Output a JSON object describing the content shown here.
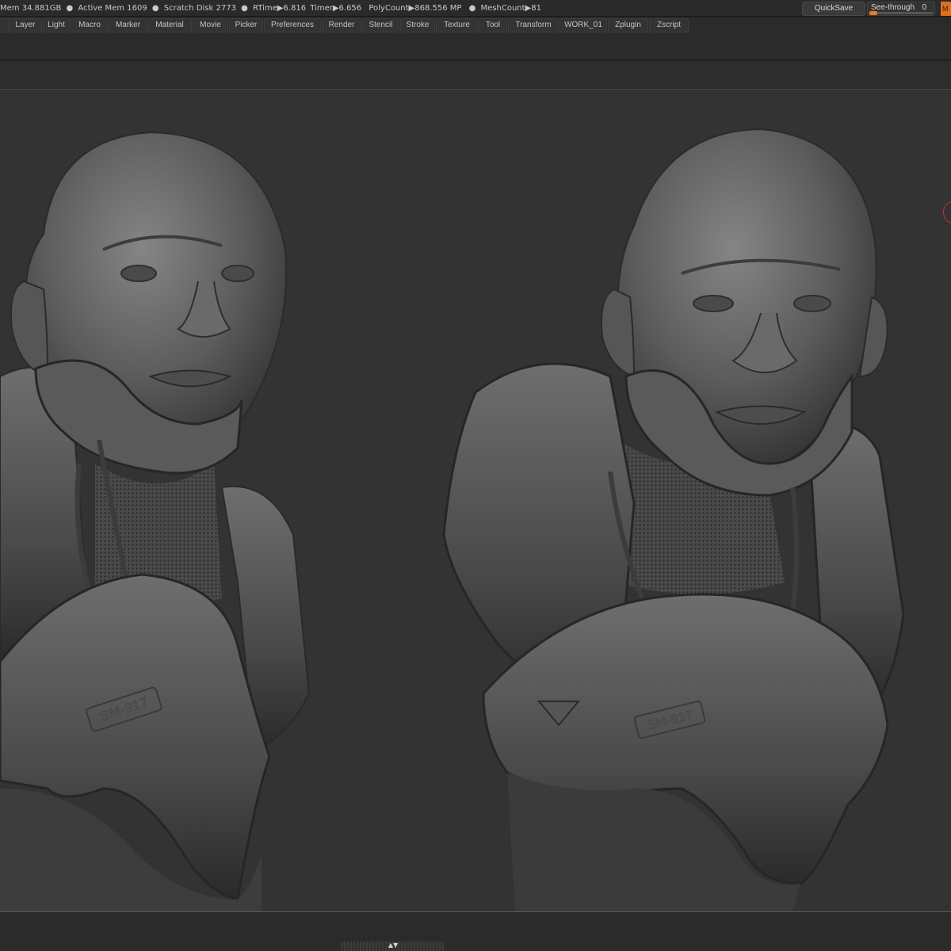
{
  "status": {
    "mem": "Mem 34.881GB",
    "active_mem": "Active Mem 1609",
    "scratch_disk": "Scratch Disk 2773",
    "rtime": "RTime▶6.816",
    "timer": "Timer▶6.656",
    "polycount": "PolyCount▶868.556 MP",
    "meshcount": "MeshCount▶81",
    "sep": "●"
  },
  "quicksave_label": "QuickSave",
  "see_through": {
    "label": "See-through",
    "value": "0",
    "level": 0
  },
  "menu_corner_label": "M",
  "menus": [
    "Layer",
    "Light",
    "Macro",
    "Marker",
    "Material",
    "Movie",
    "Picker",
    "Preferences",
    "Render",
    "Stencil",
    "Stroke",
    "Texture",
    "Tool",
    "Transform",
    "WORK_01",
    "Zplugin",
    "Zscript"
  ],
  "viewport": {
    "models": [
      {
        "name": "bust-model-left",
        "badge": "SM-917"
      },
      {
        "name": "bust-model-right",
        "badge": "SM-917"
      }
    ]
  },
  "colors": {
    "accent": "#e2701a",
    "viewport_bg": "#333333",
    "ui_bg": "#2b2b2b",
    "clay": "#5a5a5a"
  },
  "icons": {
    "handle_arrows": "collapse-expand-arrows-icon"
  }
}
